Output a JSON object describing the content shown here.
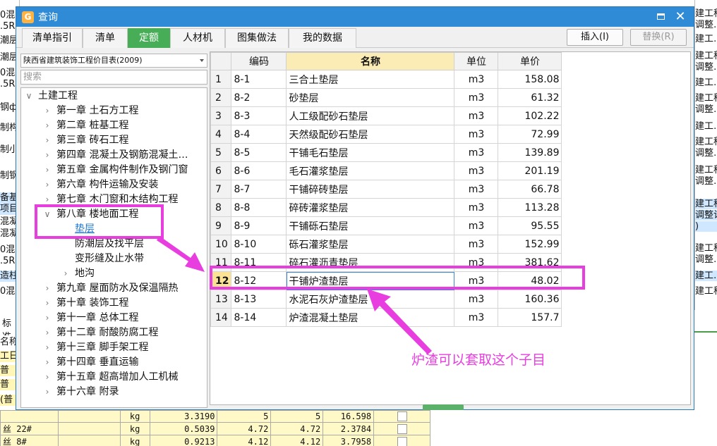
{
  "dialog": {
    "title": "查询",
    "tabs": [
      "清单指引",
      "清单",
      "定额",
      "人材机",
      "图集做法",
      "我的数据"
    ],
    "active_tab": "定额",
    "insert_label": "插入(I)",
    "replace_label": "替换(R)"
  },
  "left_panel": {
    "catalog": "陕西省建筑装饰工程价目表(2009)",
    "search_placeholder": "搜索",
    "tree": {
      "root": "土建工程",
      "chapters": [
        "第一章 土石方工程",
        "第二章 桩基工程",
        "第三章 砖石工程",
        "第四章 混凝土及钢筋混凝土…",
        "第五章 金属构件制作及钢门窗",
        "第六章 构件运输及安装",
        "第七章 木门窗和木结构工程",
        "第八章 楼地面工程",
        "第九章 屋面防水及保温隔热",
        "第十章 装饰工程",
        "第十一章 总体工程",
        "第十二章 耐酸防腐工程",
        "第十三章 脚手架工程",
        "第十四章 垂直运输",
        "第十五章 超高增加人工机械",
        "第十六章 附录"
      ],
      "chapter8_children": [
        "垫层",
        "防潮层及找平层",
        "变形缝及止水带",
        "地沟"
      ]
    }
  },
  "grid": {
    "headers": [
      "编码",
      "名称",
      "单位",
      "单价"
    ],
    "rows": [
      {
        "idx": "1",
        "code": "8-1",
        "name": "三合土垫层",
        "unit": "m3",
        "price": "158.08"
      },
      {
        "idx": "2",
        "code": "8-2",
        "name": "砂垫层",
        "unit": "m3",
        "price": "61.32"
      },
      {
        "idx": "3",
        "code": "8-3",
        "name": "人工级配砂石垫层",
        "unit": "m3",
        "price": "102.22"
      },
      {
        "idx": "4",
        "code": "8-4",
        "name": "天然级配砂石垫层",
        "unit": "m3",
        "price": "72.99"
      },
      {
        "idx": "5",
        "code": "8-5",
        "name": "干铺毛石垫层",
        "unit": "m3",
        "price": "139.89"
      },
      {
        "idx": "6",
        "code": "8-6",
        "name": "毛石灌浆垫层",
        "unit": "m3",
        "price": "201.19"
      },
      {
        "idx": "7",
        "code": "8-7",
        "name": "干铺碎砖垫层",
        "unit": "m3",
        "price": "66.78"
      },
      {
        "idx": "8",
        "code": "8-8",
        "name": "碎砖灌浆垫层",
        "unit": "m3",
        "price": "113.28"
      },
      {
        "idx": "9",
        "code": "8-9",
        "name": "干铺砾石垫层",
        "unit": "m3",
        "price": "95.55"
      },
      {
        "idx": "10",
        "code": "8-10",
        "name": "砾石灌浆垫层",
        "unit": "m3",
        "price": "152.99"
      },
      {
        "idx": "11",
        "code": "8-11",
        "name": "碎石灌沥青垫层",
        "unit": "m3",
        "price": "381.62"
      },
      {
        "idx": "12",
        "code": "8-12",
        "name": "干铺炉渣垫层",
        "unit": "m3",
        "price": "48.02"
      },
      {
        "idx": "13",
        "code": "8-13",
        "name": "水泥石灰炉渣垫层",
        "unit": "m3",
        "price": "160.36"
      },
      {
        "idx": "14",
        "code": "8-14",
        "name": "炉渣混凝土垫层",
        "unit": "m3",
        "price": "157.7"
      }
    ],
    "selected_idx": "12"
  },
  "annotation": {
    "note": "炉渣可以套取这个子目",
    "color": "#e83ee0"
  },
  "background": {
    "left_fragments": [
      "0混",
      ".5R",
      "潮层",
      "潮层",
      "0混",
      ".5R",
      "钢ф",
      "制构",
      "制小",
      "制钢",
      "备基",
      "项目",
      "混凝",
      "混凝",
      "0混",
      ".5R",
      "造柱",
      "0混"
    ],
    "right_fragments": [
      "建工程",
      "调整…",
      "建工…",
      "建工程",
      "调整…",
      "建工…",
      "建工程",
      "调整…",
      "建工…",
      "建工程",
      "调整…",
      "建工程",
      "调整…",
      "建工程",
      "调整计",
      ")",
      "建工程",
      "调整…",
      "建工…",
      "建工程"
    ],
    "bottom_left_fragments": [
      "标准",
      "名称",
      "工日",
      "普",
      "普",
      "(普"
    ],
    "bottom_rows": [
      {
        "name": "",
        "unit": "kg",
        "qty": "3.3190",
        "p1": "5",
        "p2": "5",
        "amt": "16.598"
      },
      {
        "name": "丝 22#",
        "unit": "kg",
        "qty": "0.5039",
        "p1": "4.72",
        "p2": "4.72",
        "amt": "2.3784"
      },
      {
        "name": "丝 8#",
        "unit": "kg",
        "qty": "0.9213",
        "p1": "4.12",
        "p2": "4.12",
        "amt": "3.7958"
      }
    ]
  }
}
